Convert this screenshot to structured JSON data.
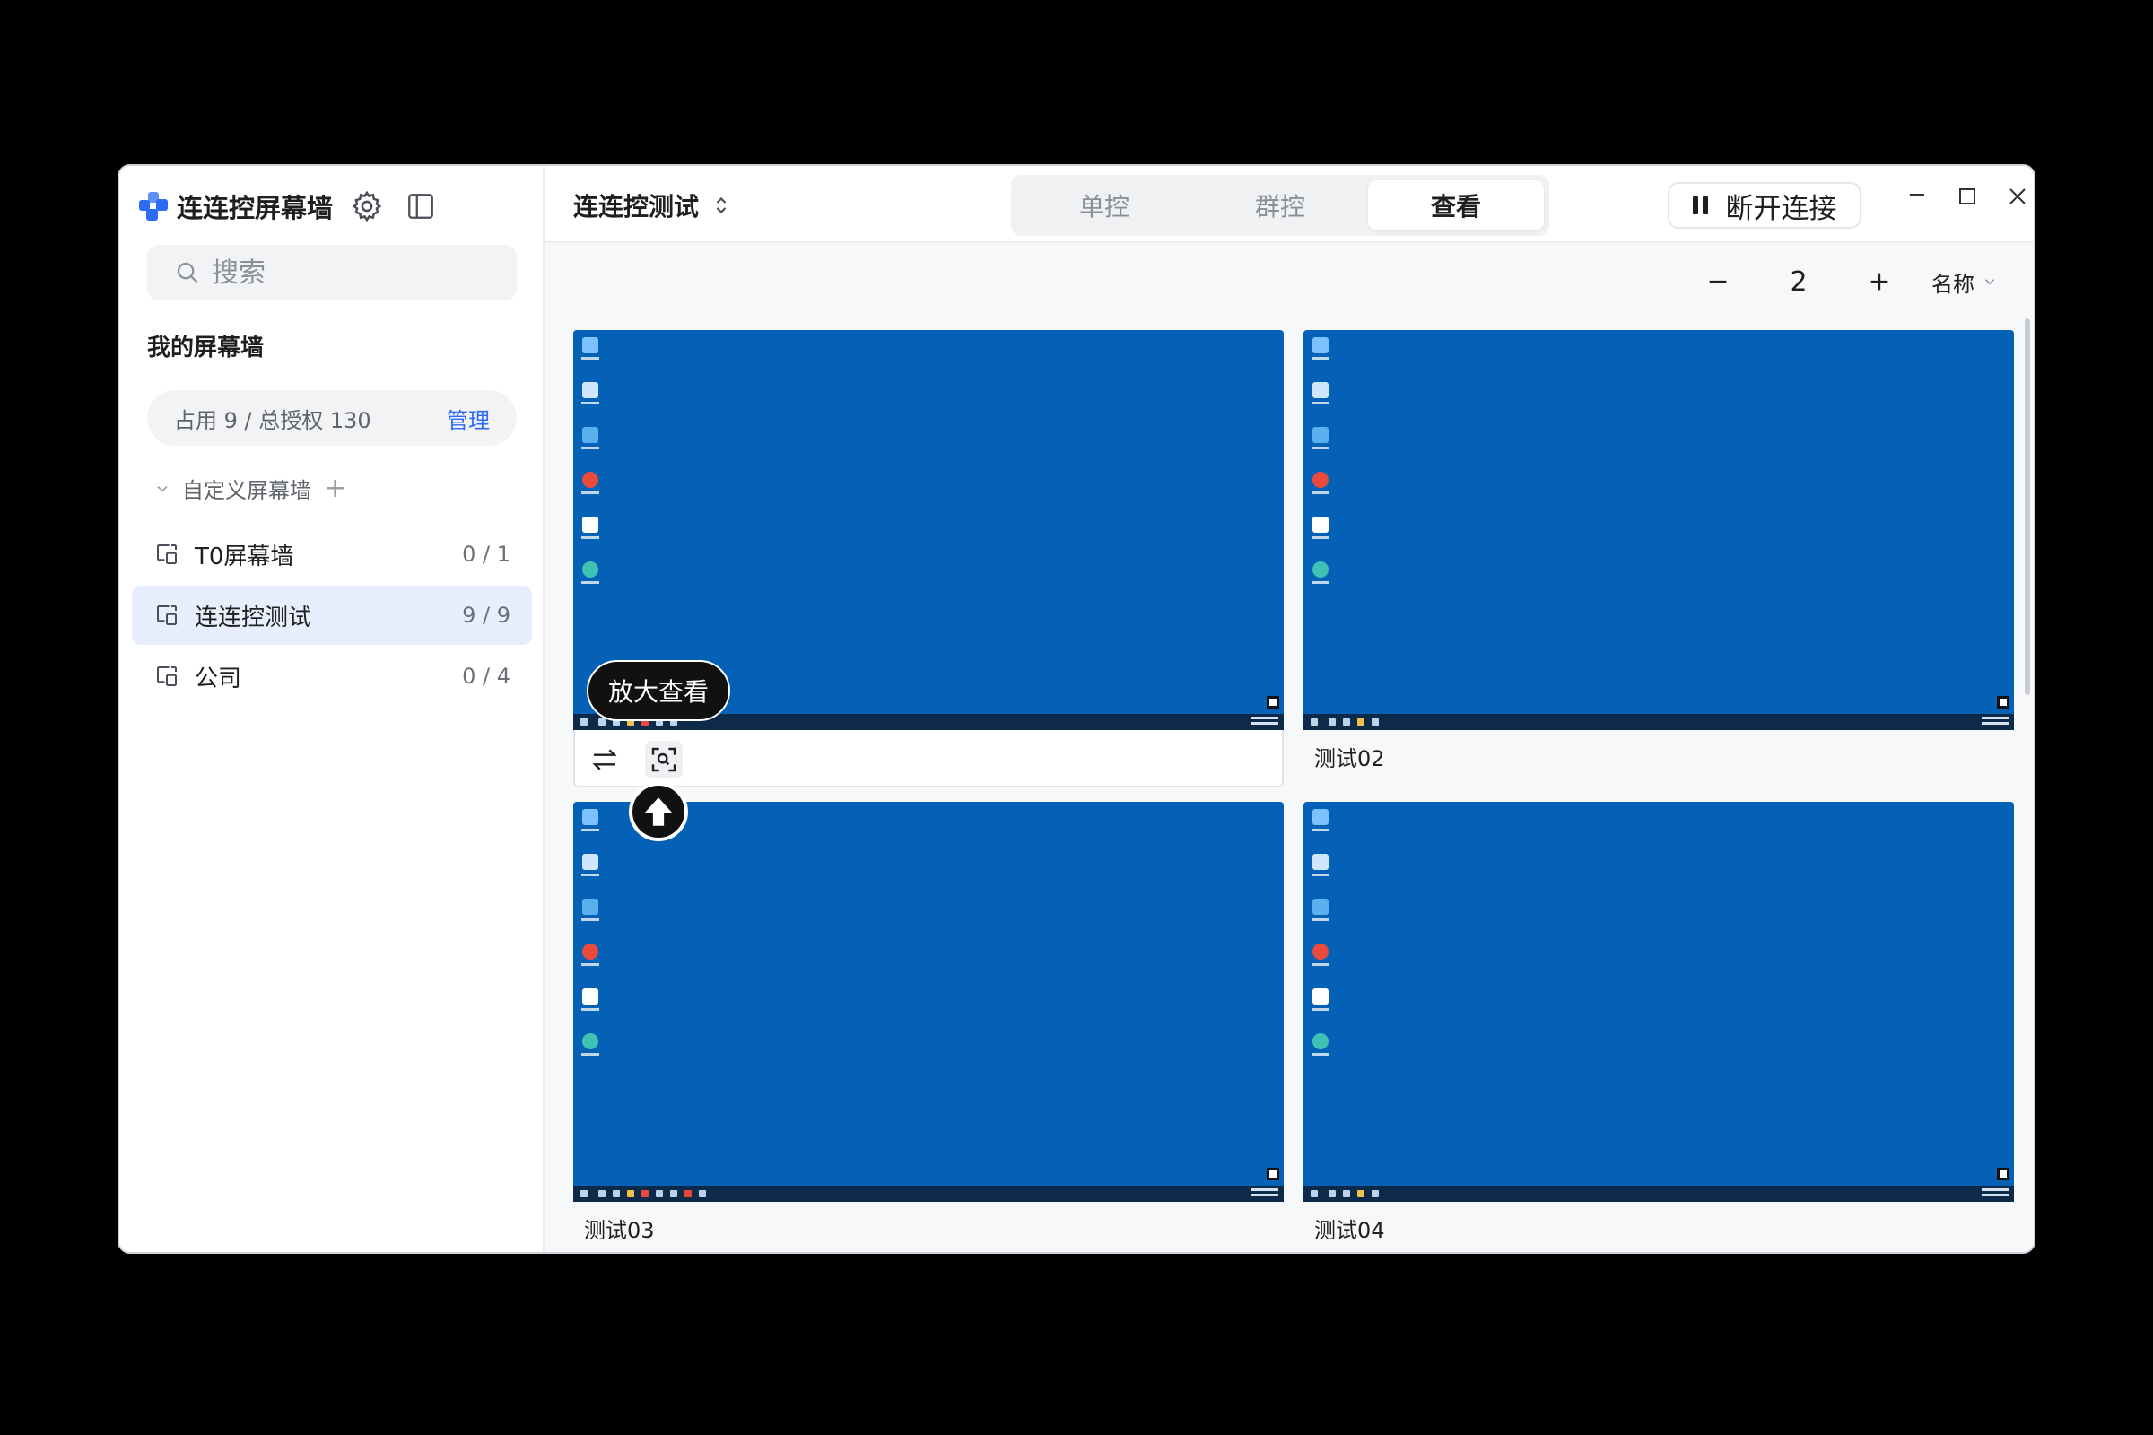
{
  "app": {
    "title": "连连控屏幕墙"
  },
  "sidebar": {
    "search_placeholder": "搜索",
    "section_title": "我的屏幕墙",
    "quota": {
      "text": "占用 9 / 总授权 130",
      "manage_label": "管理"
    },
    "custom_group_label": "自定义屏幕墙",
    "walls": [
      {
        "label": "T0屏幕墙",
        "count": "0 / 1",
        "active": false
      },
      {
        "label": "连连控测试",
        "count": "9 / 9",
        "active": true
      },
      {
        "label": "公司",
        "count": "0 / 4",
        "active": false
      }
    ]
  },
  "topbar": {
    "current_wall": "连连控测试",
    "tabs": [
      {
        "label": "单控",
        "active": false
      },
      {
        "label": "群控",
        "active": false
      },
      {
        "label": "查看",
        "active": true
      }
    ],
    "disconnect_label": "断开连接"
  },
  "toolbar": {
    "columns": "2",
    "sort_label": "名称"
  },
  "tiles": [
    {
      "name": "",
      "hovered": true
    },
    {
      "name": "测试02",
      "hovered": false
    },
    {
      "name": "测试03",
      "hovered": false
    },
    {
      "name": "测试04",
      "hovered": false
    }
  ],
  "tooltip": {
    "label": "放大查看"
  },
  "colors": {
    "accent": "#2d6bf5",
    "desktop": "#0461b6",
    "active_item_bg": "#e7effe"
  }
}
